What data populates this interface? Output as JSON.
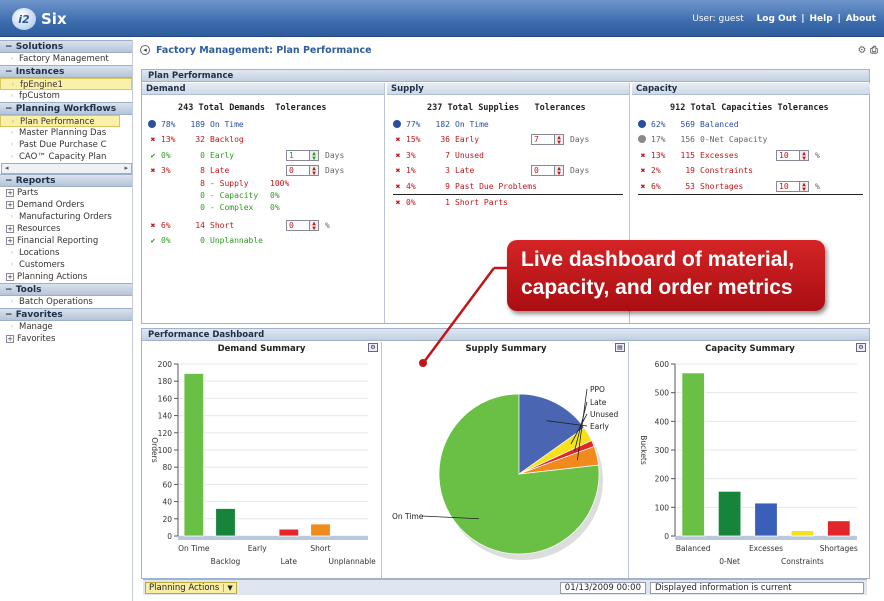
{
  "app": {
    "logo_mark": "i2",
    "title": "Six",
    "user_label": "User: guest",
    "logout": "Log Out",
    "help": "Help",
    "about": "About",
    "sep": "|"
  },
  "sidebar": {
    "solutions": {
      "title": "Solutions",
      "items": [
        "Factory Management"
      ]
    },
    "instances": {
      "title": "Instances",
      "items": [
        "fpEngine1",
        "fpCustom"
      ]
    },
    "workflows": {
      "title": "Planning Workflows",
      "items": [
        "Plan Performance",
        "Master Planning Das",
        "Past Due Purchase C",
        "CAO™ Capacity Plan"
      ]
    },
    "reports": {
      "title": "Reports",
      "items": [
        "Parts",
        "Demand Orders",
        "Manufacturing Orders",
        "Resources",
        "Financial Reporting",
        "Locations",
        "Customers",
        "Planning Actions"
      ]
    },
    "tools": {
      "title": "Tools",
      "items": [
        "Batch Operations"
      ]
    },
    "favorites": {
      "title": "Favorites",
      "items": [
        "Manage",
        "Favorites"
      ]
    }
  },
  "breadcrumb": "Factory Management: Plan Performance",
  "plan": {
    "title": "Plan Performance",
    "demand": {
      "title": "Demand",
      "total": "243",
      "total_label": "Total Demands",
      "tol": "Tolerances",
      "rows": [
        {
          "pct": "78%",
          "n": "189",
          "label": "On Time"
        },
        {
          "pct": "13%",
          "n": "32",
          "label": "Backlog"
        },
        {
          "pct": "0%",
          "n": "0",
          "label": "Early",
          "val": "1",
          "unit": "Days"
        },
        {
          "pct": "3%",
          "n": "8",
          "label": "Late",
          "val": "0",
          "unit": "Days"
        },
        {
          "n": "8",
          "label": "- Supply",
          "extra": "100%"
        },
        {
          "n": "0",
          "label": "- Capacity",
          "extra": "0%"
        },
        {
          "n": "0",
          "label": "- Complex",
          "extra": "0%"
        },
        {
          "pct": "6%",
          "n": "14",
          "label": "Short",
          "val": "0",
          "unit": "%"
        },
        {
          "pct": "0%",
          "n": "0",
          "label": "Unplannable"
        }
      ]
    },
    "supply": {
      "title": "Supply",
      "total": "237",
      "total_label": "Total Supplies",
      "tol": "Tolerances",
      "rows": [
        {
          "pct": "77%",
          "n": "182",
          "label": "On Time"
        },
        {
          "pct": "15%",
          "n": "36",
          "label": "Early",
          "val": "7",
          "unit": "Days"
        },
        {
          "pct": "3%",
          "n": "7",
          "label": "Unused"
        },
        {
          "pct": "1%",
          "n": "3",
          "label": "Late",
          "val": "0",
          "unit": "Days"
        },
        {
          "pct": "4%",
          "n": "9",
          "label": "Past Due Problems"
        },
        {
          "pct": "0%",
          "n": "1",
          "label": "Short Parts"
        }
      ]
    },
    "capacity": {
      "title": "Capacity",
      "total": "912",
      "total_label": "Total Capacities",
      "tol": "Tolerances",
      "rows": [
        {
          "pct": "62%",
          "n": "569",
          "label": "Balanced"
        },
        {
          "pct": "17%",
          "n": "156",
          "label": "0-Net Capacity"
        },
        {
          "pct": "13%",
          "n": "115",
          "label": "Excesses",
          "val": "10",
          "unit": "%"
        },
        {
          "pct": "2%",
          "n": "19",
          "label": "Constraints"
        },
        {
          "pct": "6%",
          "n": "53",
          "label": "Shortages",
          "val": "10",
          "unit": "%"
        }
      ]
    }
  },
  "dashboard": {
    "title": "Performance Dashboard"
  },
  "callout": {
    "line1": "Live dashboard of material,",
    "line2": "capacity, and order metrics"
  },
  "status": {
    "actions": "Planning Actions",
    "date": "01/13/2009 00:00",
    "msg": "Displayed information is current"
  },
  "chart_data": [
    {
      "type": "bar",
      "title": "Demand Summary",
      "ylabel": "Orders",
      "ylim": [
        0,
        200
      ],
      "yticks": [
        0,
        20,
        40,
        60,
        80,
        100,
        120,
        140,
        160,
        180,
        200
      ],
      "categories": [
        "On Time",
        "Backlog",
        "Early",
        "Late",
        "Short",
        "Unplannable"
      ],
      "values": [
        189,
        32,
        0,
        8,
        14,
        0
      ],
      "colors": [
        "#6abf45",
        "#17843c",
        "#3a5fb8",
        "#e3262a",
        "#f08a1c",
        "#888888"
      ]
    },
    {
      "type": "pie",
      "title": "Supply Summary",
      "categories": [
        "On Time",
        "Early",
        "Unused",
        "Late",
        "PPO"
      ],
      "values": [
        182,
        36,
        7,
        3,
        9
      ],
      "colors": [
        "#6abf45",
        "#4a66b3",
        "#f5e21b",
        "#e3262a",
        "#f08a1c"
      ]
    },
    {
      "type": "bar",
      "title": "Capacity Summary",
      "ylabel": "Buckets",
      "ylim": [
        0,
        600
      ],
      "yticks": [
        0,
        100,
        200,
        300,
        400,
        500,
        600
      ],
      "categories": [
        "Balanced",
        "0-Net",
        "Excesses",
        "Constraints",
        "Shortages"
      ],
      "values": [
        569,
        156,
        115,
        19,
        53
      ],
      "colors": [
        "#6abf45",
        "#17843c",
        "#3a5fb8",
        "#f5e21b",
        "#e3262a"
      ]
    }
  ]
}
